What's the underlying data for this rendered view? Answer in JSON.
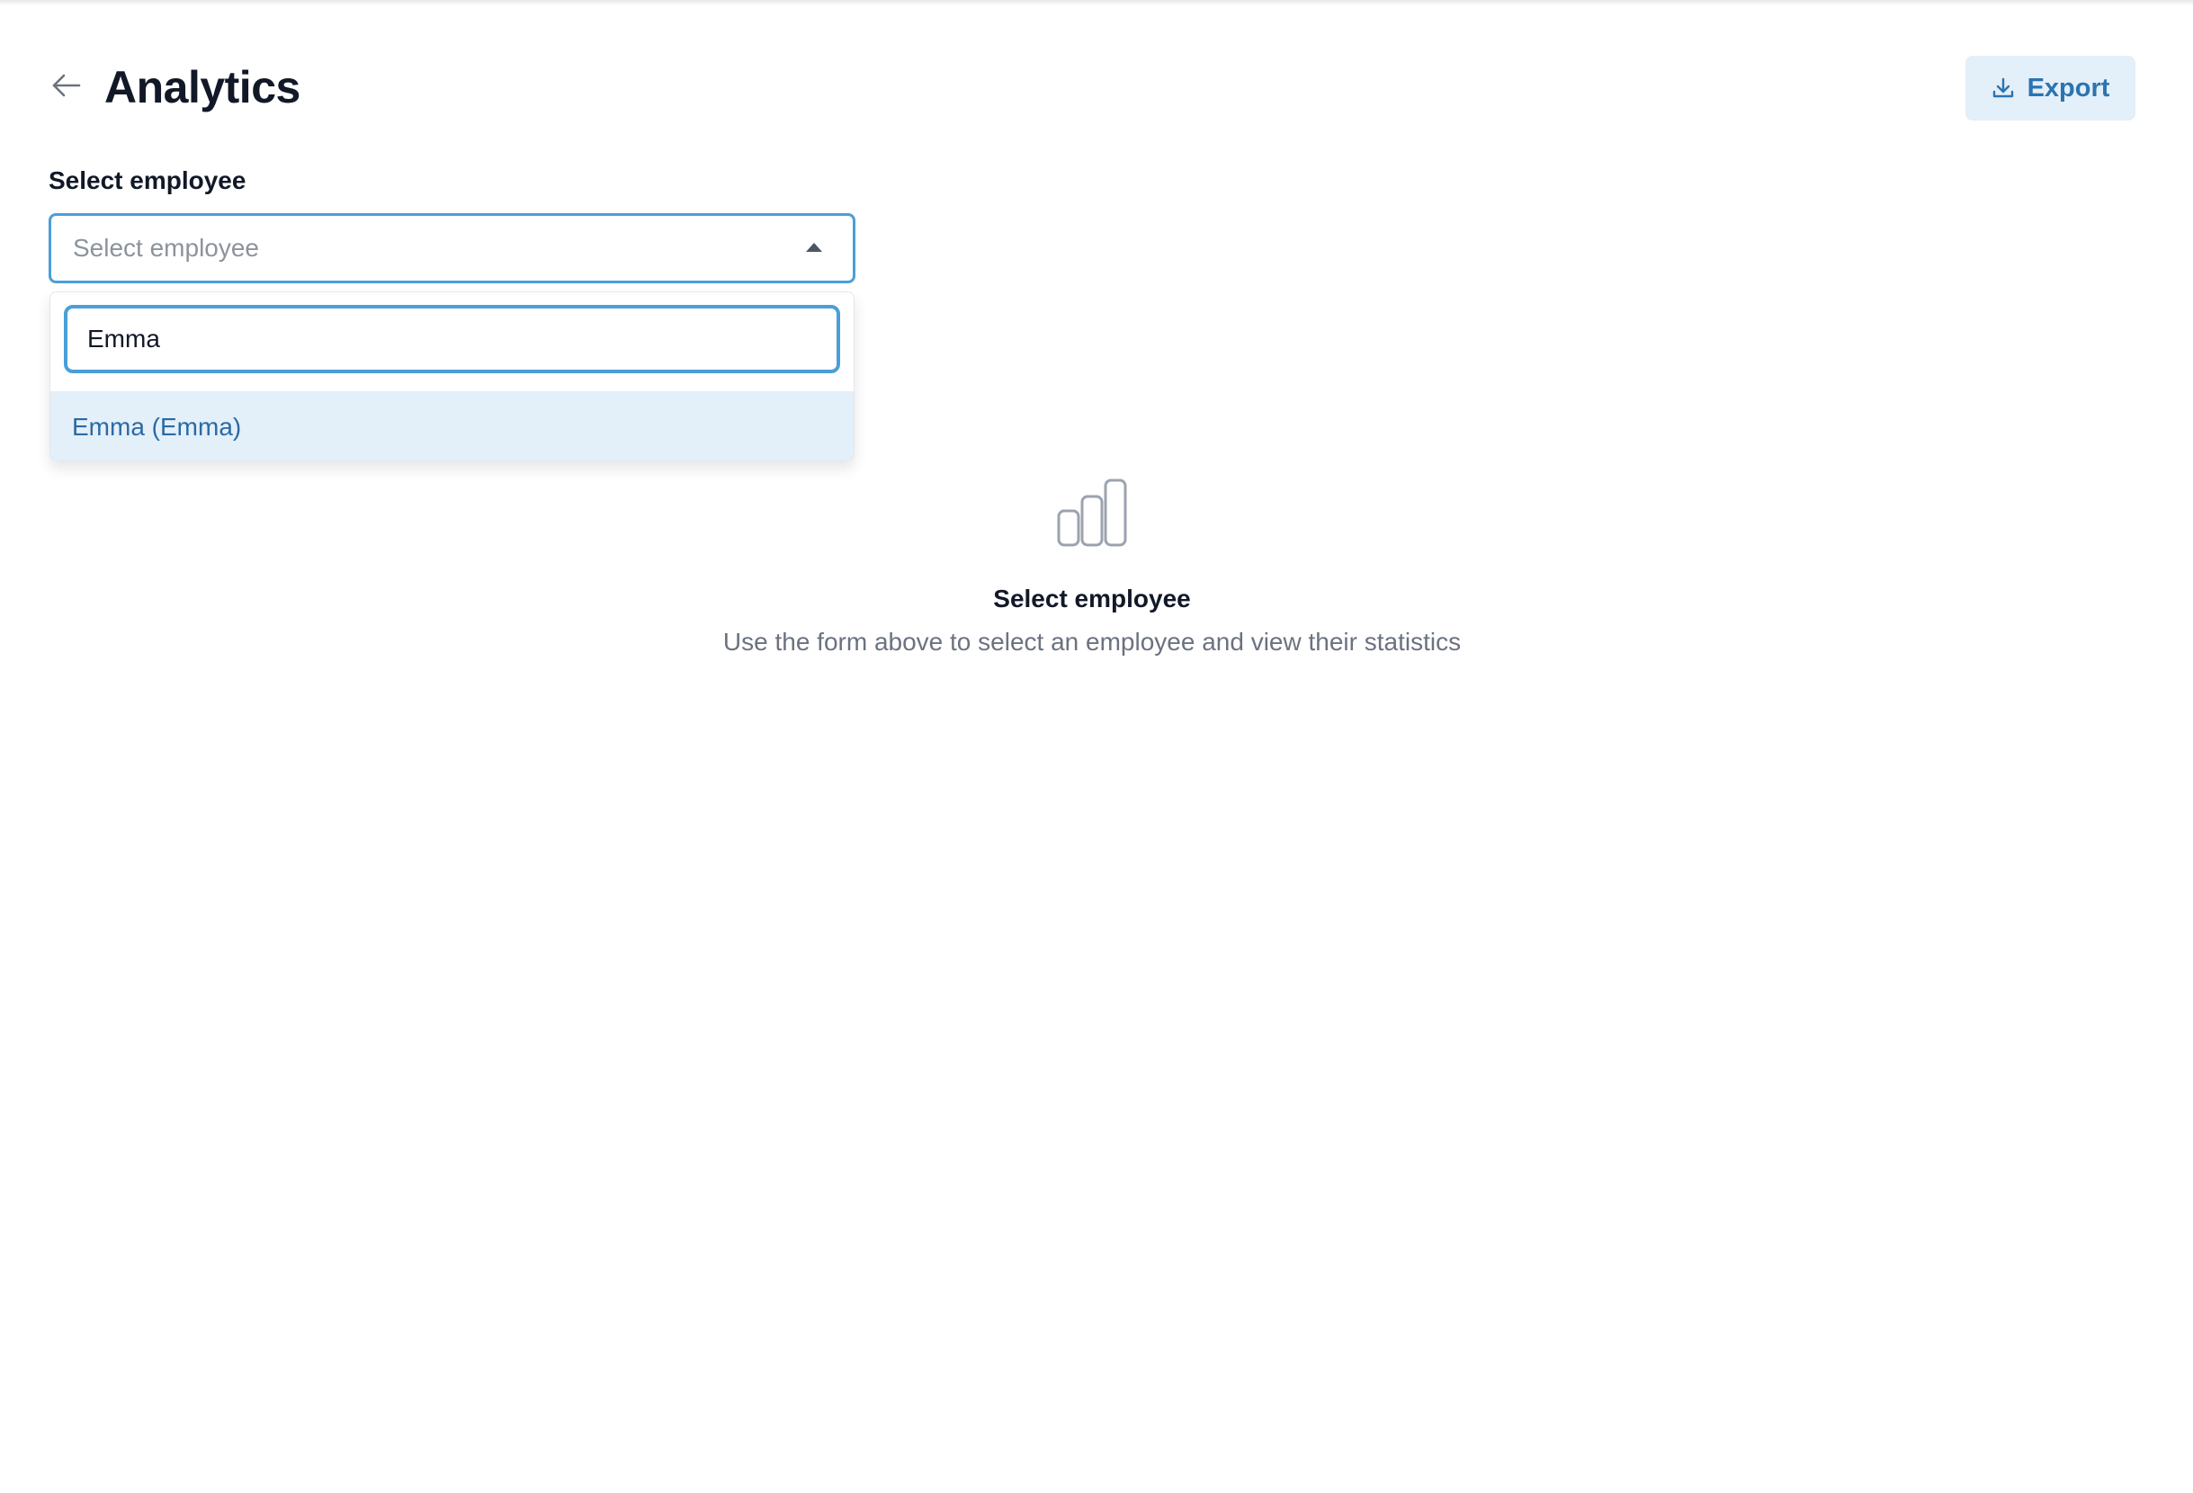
{
  "header": {
    "title": "Analytics",
    "back_icon": "arrow-left-icon",
    "export_label": "Export",
    "export_icon": "download-icon"
  },
  "employee_select": {
    "label": "Select employee",
    "placeholder": "Select employee",
    "caret_icon": "caret-up-icon",
    "search_value": "Emma",
    "options": [
      {
        "label": "Emma (Emma)",
        "highlighted": true
      }
    ]
  },
  "empty_state": {
    "icon": "bar-chart-icon",
    "title": "Select employee",
    "description": "Use the form above to select an employee and view their statistics"
  },
  "colors": {
    "accent": "#4a9fd8",
    "accent_text": "#2b74b0",
    "accent_bg": "#e3eff9",
    "muted_text": "#6b7280"
  }
}
